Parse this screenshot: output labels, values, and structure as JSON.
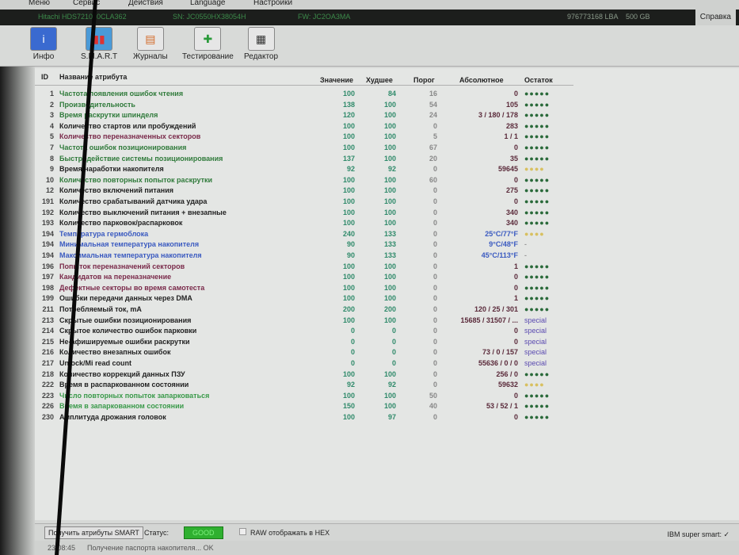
{
  "menu": {
    "items": [
      "Меню",
      "Сервис",
      "Действия",
      "Language",
      "Настройки"
    ],
    "help": "Справка"
  },
  "drive": {
    "model": "Hitachi HDS721050CLA362",
    "serial": "SN: JC0550HX38054H",
    "firmware": "FW: JC2OA3MA",
    "lba": "976773168 LBA",
    "size": "500 GB"
  },
  "toolbar": [
    {
      "label": "Инфо",
      "icon": "info-icon"
    },
    {
      "label": "S.M.A.R.T",
      "icon": "smart-icon"
    },
    {
      "label": "Журналы",
      "icon": "logs-icon"
    },
    {
      "label": "Тестирование",
      "icon": "test-icon"
    },
    {
      "label": "Редактор",
      "icon": "editor-icon"
    }
  ],
  "table": {
    "headers": {
      "id": "ID",
      "name": "Название атрибута",
      "value": "Значение",
      "worst": "Худшее",
      "threshold": "Порог",
      "raw": "Абсолютное",
      "health": "Остаток"
    },
    "rows": [
      {
        "id": "1",
        "name": "Частота появления ошибок чтения",
        "value": "100",
        "worst": "84",
        "threshold": "16",
        "raw": "0",
        "health": "●●●●●",
        "color": "#2f7a3a"
      },
      {
        "id": "2",
        "name": "Производительность",
        "value": "138",
        "worst": "100",
        "threshold": "54",
        "raw": "105",
        "health": "●●●●●",
        "color": "#2f7a3a"
      },
      {
        "id": "3",
        "name": "Время раскрутки шпинделя",
        "value": "120",
        "worst": "100",
        "threshold": "24",
        "raw": "3 / 180 / 178",
        "health": "●●●●●",
        "color": "#2f7a3a"
      },
      {
        "id": "4",
        "name": "Количество стартов или пробуждений",
        "value": "100",
        "worst": "100",
        "threshold": "0",
        "raw": "283",
        "health": "●●●●●",
        "color": "#222222"
      },
      {
        "id": "5",
        "name": "Количество переназначенных секторов",
        "value": "100",
        "worst": "100",
        "threshold": "5",
        "raw": "1 / 1",
        "health": "●●●●●",
        "color": "#7a2a4a"
      },
      {
        "id": "7",
        "name": "Частота ошибок позиционирования",
        "value": "100",
        "worst": "100",
        "threshold": "67",
        "raw": "0",
        "health": "●●●●●",
        "color": "#2f7a3a"
      },
      {
        "id": "8",
        "name": "Быстродействие системы позиционирования",
        "value": "137",
        "worst": "100",
        "threshold": "20",
        "raw": "35",
        "health": "●●●●●",
        "color": "#2f7a3a"
      },
      {
        "id": "9",
        "name": "Время наработки накопителя",
        "value": "92",
        "worst": "92",
        "threshold": "0",
        "raw": "59645",
        "health": "●●●●",
        "color": "#222222",
        "warn": true
      },
      {
        "id": "10",
        "name": "Количество повторных попыток раскрутки",
        "value": "100",
        "worst": "100",
        "threshold": "60",
        "raw": "0",
        "health": "●●●●●",
        "color": "#2f7a3a"
      },
      {
        "id": "12",
        "name": "Количество включений питания",
        "value": "100",
        "worst": "100",
        "threshold": "0",
        "raw": "275",
        "health": "●●●●●",
        "color": "#222222"
      },
      {
        "id": "191",
        "name": "Количество срабатываний датчика удара",
        "value": "100",
        "worst": "100",
        "threshold": "0",
        "raw": "0",
        "health": "●●●●●",
        "color": "#222222"
      },
      {
        "id": "192",
        "name": "Количество выключений питания + внезапные",
        "value": "100",
        "worst": "100",
        "threshold": "0",
        "raw": "340",
        "health": "●●●●●",
        "color": "#222222"
      },
      {
        "id": "193",
        "name": "Количество парковок/распарковок",
        "value": "100",
        "worst": "100",
        "threshold": "0",
        "raw": "340",
        "health": "●●●●●",
        "color": "#222222"
      },
      {
        "id": "194",
        "name": "Температура гермоблока",
        "value": "240",
        "worst": "133",
        "threshold": "0",
        "raw": "25°C/77°F",
        "health": "●●●●",
        "color": "#3a5ac0",
        "warn": true
      },
      {
        "id": "194",
        "name": "Минимальная температура накопителя",
        "value": "90",
        "worst": "133",
        "threshold": "0",
        "raw": "9°C/48°F",
        "health": "-",
        "color": "#3a5ac0"
      },
      {
        "id": "194",
        "name": "Максимальная температура накопителя",
        "value": "90",
        "worst": "133",
        "threshold": "0",
        "raw": "45°C/113°F",
        "health": "-",
        "color": "#3a5ac0"
      },
      {
        "id": "196",
        "name": "Попыток переназначений секторов",
        "value": "100",
        "worst": "100",
        "threshold": "0",
        "raw": "1",
        "health": "●●●●●",
        "color": "#7a2a4a"
      },
      {
        "id": "197",
        "name": "Кандидатов на переназначение",
        "value": "100",
        "worst": "100",
        "threshold": "0",
        "raw": "0",
        "health": "●●●●●",
        "color": "#7a2a4a"
      },
      {
        "id": "198",
        "name": "Дефектные секторы во время самотеста",
        "value": "100",
        "worst": "100",
        "threshold": "0",
        "raw": "0",
        "health": "●●●●●",
        "color": "#7a2a4a"
      },
      {
        "id": "199",
        "name": "Ошибки передачи данных через DMA",
        "value": "100",
        "worst": "100",
        "threshold": "0",
        "raw": "1",
        "health": "●●●●●",
        "color": "#222222"
      },
      {
        "id": "211",
        "name": "Потребляемый ток, mA",
        "value": "200",
        "worst": "200",
        "threshold": "0",
        "raw": "120 / 25 / 301",
        "health": "●●●●●",
        "color": "#222222"
      },
      {
        "id": "213",
        "name": "Скрытые ошибки позиционирования",
        "value": "100",
        "worst": "100",
        "threshold": "0",
        "raw": "15685 / 31507 / ...",
        "health": "special",
        "color": "#222222"
      },
      {
        "id": "214",
        "name": "Скрытое количество ошибок парковки",
        "value": "0",
        "worst": "0",
        "threshold": "0",
        "raw": "0",
        "health": "special",
        "color": "#222222"
      },
      {
        "id": "215",
        "name": "Не-афишируемые ошибки раскрутки",
        "value": "0",
        "worst": "0",
        "threshold": "0",
        "raw": "0",
        "health": "special",
        "color": "#222222"
      },
      {
        "id": "216",
        "name": "Количество внезапных ошибок",
        "value": "0",
        "worst": "0",
        "threshold": "0",
        "raw": "73 / 0 / 157",
        "health": "special",
        "color": "#222222"
      },
      {
        "id": "217",
        "name": "Unlock/Mi read count",
        "value": "0",
        "worst": "0",
        "threshold": "0",
        "raw": "55636 / 0 / 0",
        "health": "special",
        "color": "#222222"
      },
      {
        "id": "218",
        "name": "Количество коррекций данных ПЗУ",
        "value": "100",
        "worst": "100",
        "threshold": "0",
        "raw": "256 / 0",
        "health": "●●●●●",
        "color": "#222222"
      },
      {
        "id": "222",
        "name": "Время в распаркованном состоянии",
        "value": "92",
        "worst": "92",
        "threshold": "0",
        "raw": "59632",
        "health": "●●●●",
        "color": "#222222",
        "warn": true
      },
      {
        "id": "223",
        "name": "Число повторных попыток запарковаться",
        "value": "100",
        "worst": "100",
        "threshold": "50",
        "raw": "0",
        "health": "●●●●●",
        "color": "#3a9a4a"
      },
      {
        "id": "226",
        "name": "Время в запаркованном состоянии",
        "value": "150",
        "worst": "100",
        "threshold": "40",
        "raw": "53 / 52 / 1",
        "health": "●●●●●",
        "color": "#3a9a4a"
      },
      {
        "id": "230",
        "name": "Амплитуда дрожания головок",
        "value": "100",
        "worst": "97",
        "threshold": "0",
        "raw": "0",
        "health": "●●●●●",
        "color": "#222222"
      }
    ]
  },
  "bottom": {
    "get_smart": "Получить атрибуты SMART",
    "status_label": "Статус:",
    "status": "GOOD",
    "raw_hex": "RAW отображать в HEX",
    "ibm": "IBM super smart: ✓"
  },
  "log": {
    "time": "23:08:45",
    "message": "Получение паспорта накопителя... OK"
  },
  "colors": {
    "good": "#2fb030",
    "health_ok": "#2a6a3a",
    "health_warn": "#d8c060",
    "special": "#5a4ab0"
  }
}
